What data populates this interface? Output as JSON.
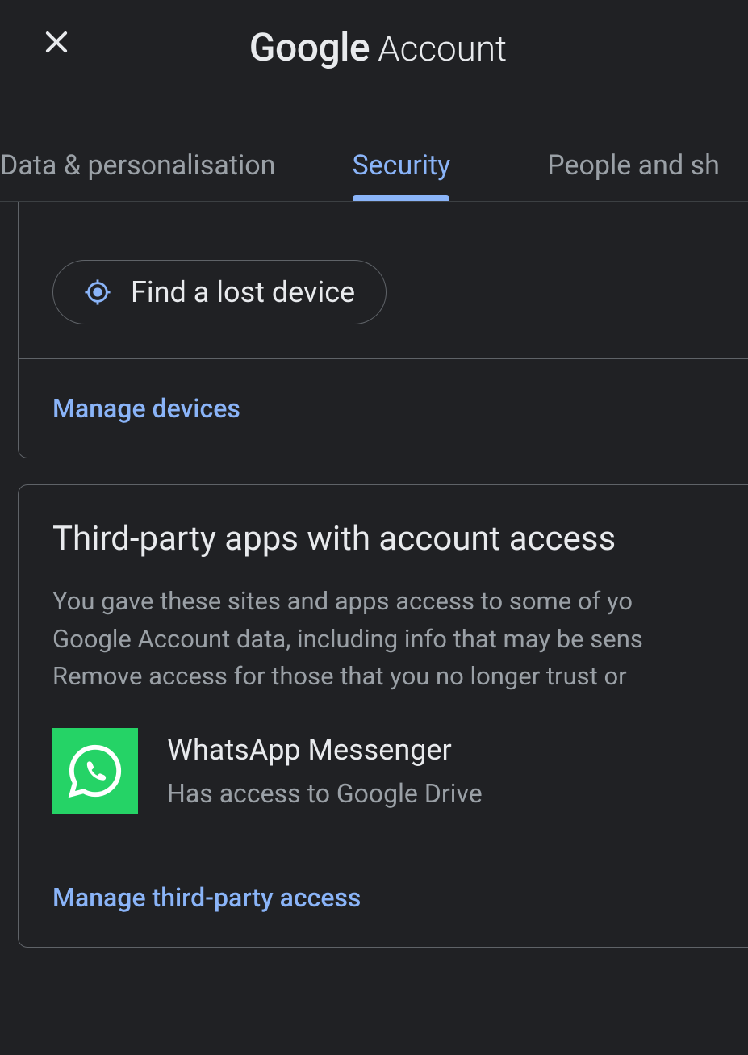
{
  "header": {
    "title_bold": "Google",
    "title_light": "Account"
  },
  "tabs": {
    "data_personalisation": "Data & personalisation",
    "security": "Security",
    "people_sharing": "People and sh"
  },
  "devices_card": {
    "find_device_label": "Find a lost device",
    "manage_devices_label": "Manage devices"
  },
  "third_party_card": {
    "title": "Third-party apps with account access",
    "desc_line1": "You gave these sites and apps access to some of yo",
    "desc_line2": "Google Account data, including info that may be sens",
    "desc_line3": "Remove access for those that you no longer trust or ",
    "app": {
      "name": "WhatsApp Messenger",
      "access": "Has access to Google Drive"
    },
    "manage_label": "Manage third-party access"
  }
}
